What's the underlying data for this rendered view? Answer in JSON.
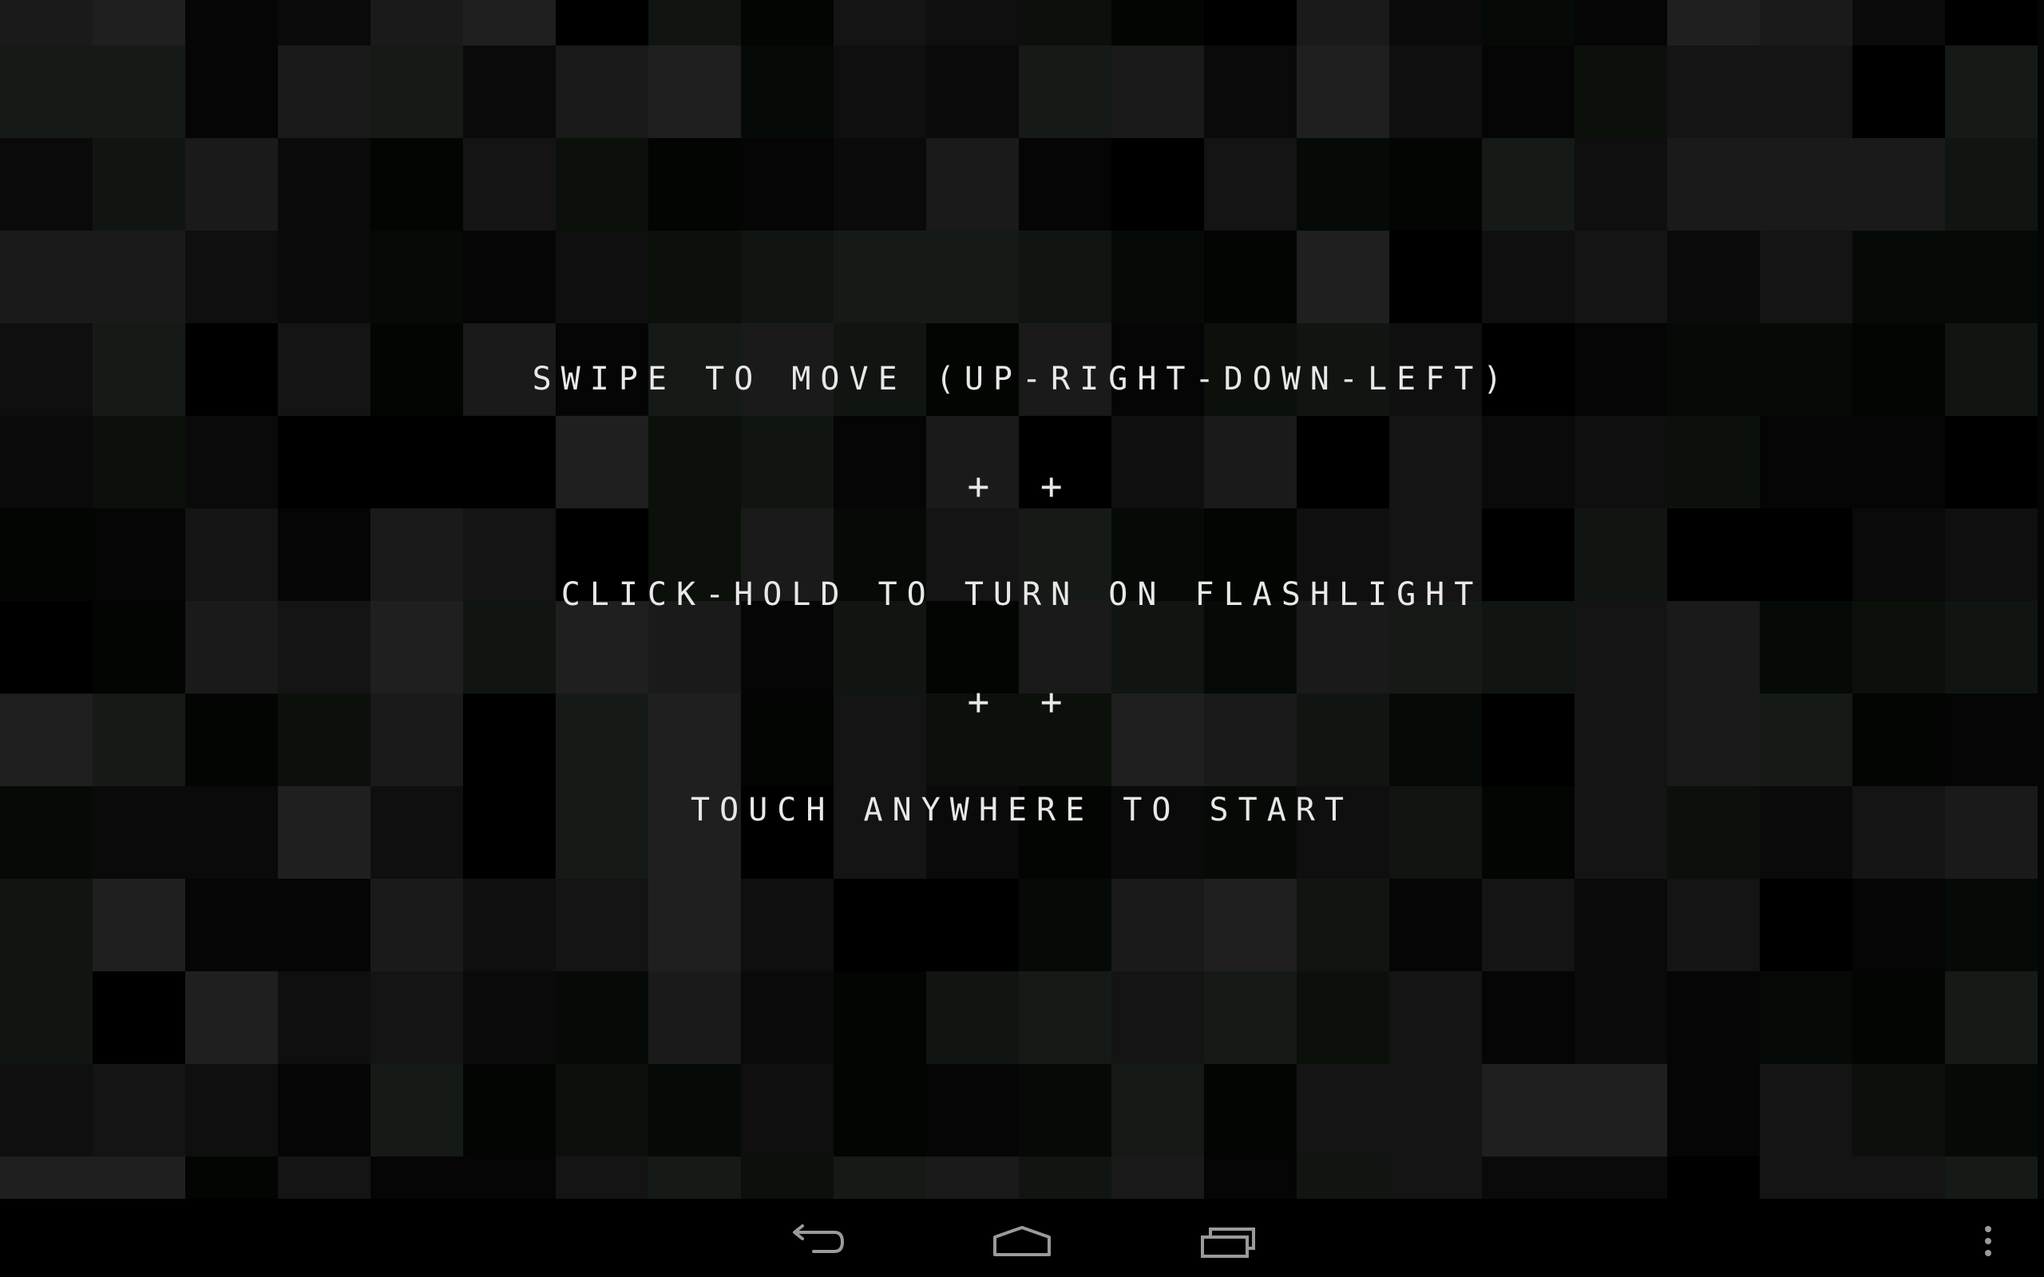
{
  "instructions": {
    "line1": "SWIPE TO MOVE (UP-RIGHT-DOWN-LEFT)",
    "separator1": "+ +",
    "line2": "CLICK-HOLD TO TURN ON FLASHLIGHT",
    "separator2": "+ +",
    "line3": "TOUCH ANYWHERE TO START"
  },
  "colors": {
    "text": "#e8e8e8",
    "background": "#000000",
    "nav_icon": "#9a9a9a",
    "tile_palette": [
      "#000000",
      "#050505",
      "#0a0a0a",
      "#0f0f0f",
      "#141414",
      "#1a1a1a",
      "#1f1f1f",
      "#020502",
      "#060a06",
      "#0b100b",
      "#101511",
      "#151a16"
    ]
  },
  "navigation": {
    "back": "back-icon",
    "home": "home-icon",
    "recents": "recent-apps-icon",
    "menu": "overflow-menu-icon"
  }
}
